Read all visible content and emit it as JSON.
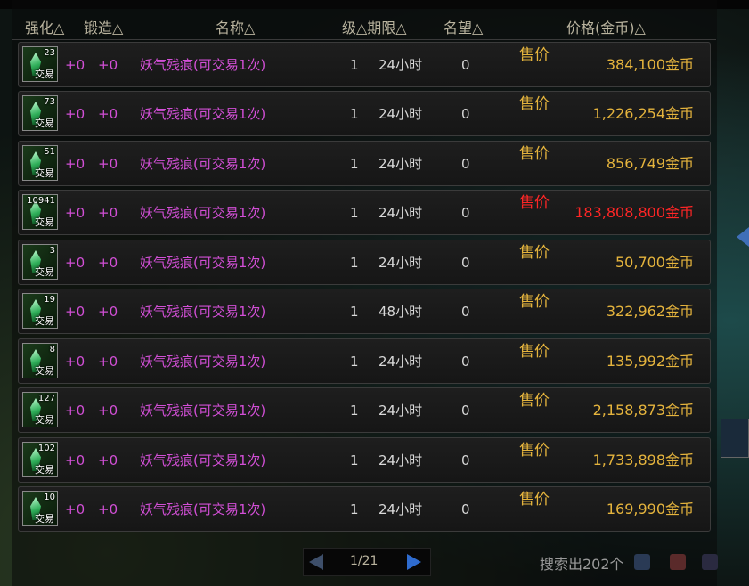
{
  "header": {
    "enhance": "强化△",
    "forge": "锻造△",
    "name": "名称△",
    "level_duration": "级△期限△",
    "reputation": "名望△",
    "price": "价格(金币)△"
  },
  "rows": [
    {
      "qty": "23",
      "trade": "交易",
      "enhance": "+0",
      "forge": "+0",
      "name": "妖气残痕(可交易1次)",
      "level": "1",
      "duration": "24小时",
      "reputation": "0",
      "sell": "售价",
      "price": "384,100金币",
      "highlight": false
    },
    {
      "qty": "73",
      "trade": "交易",
      "enhance": "+0",
      "forge": "+0",
      "name": "妖气残痕(可交易1次)",
      "level": "1",
      "duration": "24小时",
      "reputation": "0",
      "sell": "售价",
      "price": "1,226,254金币",
      "highlight": false
    },
    {
      "qty": "51",
      "trade": "交易",
      "enhance": "+0",
      "forge": "+0",
      "name": "妖气残痕(可交易1次)",
      "level": "1",
      "duration": "24小时",
      "reputation": "0",
      "sell": "售价",
      "price": "856,749金币",
      "highlight": false
    },
    {
      "qty": "10941",
      "trade": "交易",
      "enhance": "+0",
      "forge": "+0",
      "name": "妖气残痕(可交易1次)",
      "level": "1",
      "duration": "24小时",
      "reputation": "0",
      "sell": "售价",
      "price": "183,808,800金币",
      "highlight": true
    },
    {
      "qty": "3",
      "trade": "交易",
      "enhance": "+0",
      "forge": "+0",
      "name": "妖气残痕(可交易1次)",
      "level": "1",
      "duration": "24小时",
      "reputation": "0",
      "sell": "售价",
      "price": "50,700金币",
      "highlight": false
    },
    {
      "qty": "19",
      "trade": "交易",
      "enhance": "+0",
      "forge": "+0",
      "name": "妖气残痕(可交易1次)",
      "level": "1",
      "duration": "48小时",
      "reputation": "0",
      "sell": "售价",
      "price": "322,962金币",
      "highlight": false
    },
    {
      "qty": "8",
      "trade": "交易",
      "enhance": "+0",
      "forge": "+0",
      "name": "妖气残痕(可交易1次)",
      "level": "1",
      "duration": "24小时",
      "reputation": "0",
      "sell": "售价",
      "price": "135,992金币",
      "highlight": false
    },
    {
      "qty": "127",
      "trade": "交易",
      "enhance": "+0",
      "forge": "+0",
      "name": "妖气残痕(可交易1次)",
      "level": "1",
      "duration": "24小时",
      "reputation": "0",
      "sell": "售价",
      "price": "2,158,873金币",
      "highlight": false
    },
    {
      "qty": "102",
      "trade": "交易",
      "enhance": "+0",
      "forge": "+0",
      "name": "妖气残痕(可交易1次)",
      "level": "1",
      "duration": "24小时",
      "reputation": "0",
      "sell": "售价",
      "price": "1,733,898金币",
      "highlight": false
    },
    {
      "qty": "10",
      "trade": "交易",
      "enhance": "+0",
      "forge": "+0",
      "name": "妖气残痕(可交易1次)",
      "level": "1",
      "duration": "24小时",
      "reputation": "0",
      "sell": "售价",
      "price": "169,990金币",
      "highlight": false
    }
  ],
  "pagination": {
    "page_text": "1/21"
  },
  "search_count": "搜索出202个",
  "colors": {
    "price": "#e5b43d",
    "highlight": "#ff2626",
    "item_name": "#d24fd6"
  },
  "icons": {
    "item": "green-crystal-shard-icon",
    "prev": "prev-page-arrow-icon",
    "next": "next-page-arrow-icon"
  }
}
